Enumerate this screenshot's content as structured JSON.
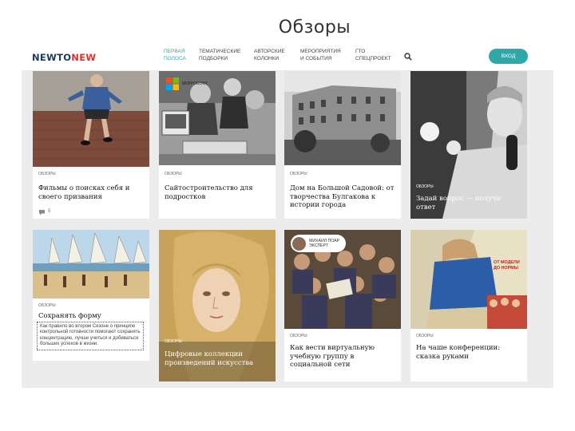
{
  "slide_title": "Обзоры",
  "header": {
    "logo_a": "NEWTO",
    "logo_b": "NEW",
    "nav": [
      {
        "line1": "ПЕРВАЯ",
        "line2": "ПОЛОСА",
        "active": true
      },
      {
        "line1": "ТЕМАТИЧЕСКИЕ",
        "line2": "ПОДБОРКИ",
        "active": false
      },
      {
        "line1": "АВТОРСКИЕ",
        "line2": "КОЛОНКИ",
        "active": false
      },
      {
        "line1": "МЕРОПРИЯТИЯ",
        "line2": "И СОБЫТИЯ",
        "active": false
      },
      {
        "line1": "ГТО",
        "line2": "СПЕЦПРОЕКТ",
        "active": false
      }
    ],
    "search_icon": "search-icon",
    "login_label": "ВХОД"
  },
  "cards": [
    {
      "tag": "ОБЗОРЫ",
      "title": "Фильмы о поисках себя и своего призвания",
      "comments": "5"
    },
    {
      "badge": "МИКРОСОФТ",
      "tag": "ОБЗОРЫ",
      "title": "Сайтостроительство для подростков"
    },
    {
      "tag": "ОБЗОРЫ",
      "title": "Дом на Большой Садовой: от творчества Булгакова к истории города"
    },
    {
      "tag": "ОБЗОРЫ",
      "title": "Задай вопрос — получи ответ"
    },
    {
      "tag": "ОБЗОРЫ",
      "title": "Сохранять форму",
      "lead": "Как правило во втором Сезоне о принципе контрольной готовности помогают сохранять концентрацию, лучше учиться и добиваться больших успехов в жизни."
    },
    {
      "tag": "ОБЗОРЫ",
      "title": "Цифровые коллекции произведений искусства"
    },
    {
      "author": "МИХАИЛ ПОАР",
      "author_role": "ЭКСПЕРТ",
      "tag": "ОБЗОРЫ",
      "title": "Как вести виртуальную учебную группу в социальной сети"
    },
    {
      "poster": "ОТ МОДЕЛИ ДО НОРМЫ",
      "tag": "ОБЗОРЫ",
      "title": "На чаше конференции: сказка руками"
    }
  ],
  "colors": {
    "accent": "#2fa8a8",
    "logo": "#1b3a5c",
    "logo_red": "#e0312d"
  }
}
